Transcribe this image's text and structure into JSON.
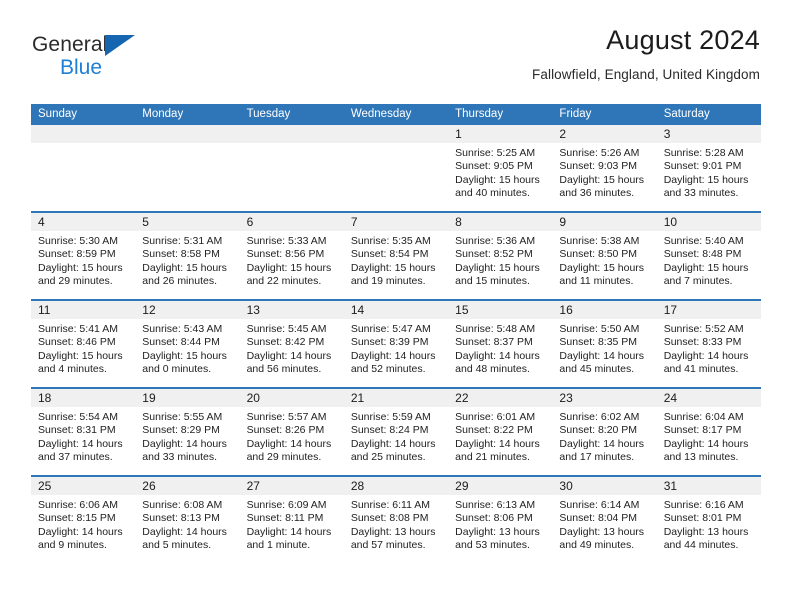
{
  "brand": {
    "name_part1": "General",
    "name_part2": "Blue",
    "accent_color": "#1e7fd4",
    "triangle_color": "#1565b0"
  },
  "header": {
    "title": "August 2024",
    "subtitle": "Fallowfield, England, United Kingdom"
  },
  "theme": {
    "header_blue": "#2f76b8",
    "day_number_band": "#f0f0f0",
    "text": "#222222"
  },
  "weekdays": [
    "Sunday",
    "Monday",
    "Tuesday",
    "Wednesday",
    "Thursday",
    "Friday",
    "Saturday"
  ],
  "weeks": [
    [
      {
        "day": "",
        "empty": true
      },
      {
        "day": "",
        "empty": true
      },
      {
        "day": "",
        "empty": true
      },
      {
        "day": "",
        "empty": true
      },
      {
        "day": "1",
        "sunrise": "Sunrise: 5:25 AM",
        "sunset": "Sunset: 9:05 PM",
        "daylight": "Daylight: 15 hours and 40 minutes."
      },
      {
        "day": "2",
        "sunrise": "Sunrise: 5:26 AM",
        "sunset": "Sunset: 9:03 PM",
        "daylight": "Daylight: 15 hours and 36 minutes."
      },
      {
        "day": "3",
        "sunrise": "Sunrise: 5:28 AM",
        "sunset": "Sunset: 9:01 PM",
        "daylight": "Daylight: 15 hours and 33 minutes."
      }
    ],
    [
      {
        "day": "4",
        "sunrise": "Sunrise: 5:30 AM",
        "sunset": "Sunset: 8:59 PM",
        "daylight": "Daylight: 15 hours and 29 minutes."
      },
      {
        "day": "5",
        "sunrise": "Sunrise: 5:31 AM",
        "sunset": "Sunset: 8:58 PM",
        "daylight": "Daylight: 15 hours and 26 minutes."
      },
      {
        "day": "6",
        "sunrise": "Sunrise: 5:33 AM",
        "sunset": "Sunset: 8:56 PM",
        "daylight": "Daylight: 15 hours and 22 minutes."
      },
      {
        "day": "7",
        "sunrise": "Sunrise: 5:35 AM",
        "sunset": "Sunset: 8:54 PM",
        "daylight": "Daylight: 15 hours and 19 minutes."
      },
      {
        "day": "8",
        "sunrise": "Sunrise: 5:36 AM",
        "sunset": "Sunset: 8:52 PM",
        "daylight": "Daylight: 15 hours and 15 minutes."
      },
      {
        "day": "9",
        "sunrise": "Sunrise: 5:38 AM",
        "sunset": "Sunset: 8:50 PM",
        "daylight": "Daylight: 15 hours and 11 minutes."
      },
      {
        "day": "10",
        "sunrise": "Sunrise: 5:40 AM",
        "sunset": "Sunset: 8:48 PM",
        "daylight": "Daylight: 15 hours and 7 minutes."
      }
    ],
    [
      {
        "day": "11",
        "sunrise": "Sunrise: 5:41 AM",
        "sunset": "Sunset: 8:46 PM",
        "daylight": "Daylight: 15 hours and 4 minutes."
      },
      {
        "day": "12",
        "sunrise": "Sunrise: 5:43 AM",
        "sunset": "Sunset: 8:44 PM",
        "daylight": "Daylight: 15 hours and 0 minutes."
      },
      {
        "day": "13",
        "sunrise": "Sunrise: 5:45 AM",
        "sunset": "Sunset: 8:42 PM",
        "daylight": "Daylight: 14 hours and 56 minutes."
      },
      {
        "day": "14",
        "sunrise": "Sunrise: 5:47 AM",
        "sunset": "Sunset: 8:39 PM",
        "daylight": "Daylight: 14 hours and 52 minutes."
      },
      {
        "day": "15",
        "sunrise": "Sunrise: 5:48 AM",
        "sunset": "Sunset: 8:37 PM",
        "daylight": "Daylight: 14 hours and 48 minutes."
      },
      {
        "day": "16",
        "sunrise": "Sunrise: 5:50 AM",
        "sunset": "Sunset: 8:35 PM",
        "daylight": "Daylight: 14 hours and 45 minutes."
      },
      {
        "day": "17",
        "sunrise": "Sunrise: 5:52 AM",
        "sunset": "Sunset: 8:33 PM",
        "daylight": "Daylight: 14 hours and 41 minutes."
      }
    ],
    [
      {
        "day": "18",
        "sunrise": "Sunrise: 5:54 AM",
        "sunset": "Sunset: 8:31 PM",
        "daylight": "Daylight: 14 hours and 37 minutes."
      },
      {
        "day": "19",
        "sunrise": "Sunrise: 5:55 AM",
        "sunset": "Sunset: 8:29 PM",
        "daylight": "Daylight: 14 hours and 33 minutes."
      },
      {
        "day": "20",
        "sunrise": "Sunrise: 5:57 AM",
        "sunset": "Sunset: 8:26 PM",
        "daylight": "Daylight: 14 hours and 29 minutes."
      },
      {
        "day": "21",
        "sunrise": "Sunrise: 5:59 AM",
        "sunset": "Sunset: 8:24 PM",
        "daylight": "Daylight: 14 hours and 25 minutes."
      },
      {
        "day": "22",
        "sunrise": "Sunrise: 6:01 AM",
        "sunset": "Sunset: 8:22 PM",
        "daylight": "Daylight: 14 hours and 21 minutes."
      },
      {
        "day": "23",
        "sunrise": "Sunrise: 6:02 AM",
        "sunset": "Sunset: 8:20 PM",
        "daylight": "Daylight: 14 hours and 17 minutes."
      },
      {
        "day": "24",
        "sunrise": "Sunrise: 6:04 AM",
        "sunset": "Sunset: 8:17 PM",
        "daylight": "Daylight: 14 hours and 13 minutes."
      }
    ],
    [
      {
        "day": "25",
        "sunrise": "Sunrise: 6:06 AM",
        "sunset": "Sunset: 8:15 PM",
        "daylight": "Daylight: 14 hours and 9 minutes."
      },
      {
        "day": "26",
        "sunrise": "Sunrise: 6:08 AM",
        "sunset": "Sunset: 8:13 PM",
        "daylight": "Daylight: 14 hours and 5 minutes."
      },
      {
        "day": "27",
        "sunrise": "Sunrise: 6:09 AM",
        "sunset": "Sunset: 8:11 PM",
        "daylight": "Daylight: 14 hours and 1 minute."
      },
      {
        "day": "28",
        "sunrise": "Sunrise: 6:11 AM",
        "sunset": "Sunset: 8:08 PM",
        "daylight": "Daylight: 13 hours and 57 minutes."
      },
      {
        "day": "29",
        "sunrise": "Sunrise: 6:13 AM",
        "sunset": "Sunset: 8:06 PM",
        "daylight": "Daylight: 13 hours and 53 minutes."
      },
      {
        "day": "30",
        "sunrise": "Sunrise: 6:14 AM",
        "sunset": "Sunset: 8:04 PM",
        "daylight": "Daylight: 13 hours and 49 minutes."
      },
      {
        "day": "31",
        "sunrise": "Sunrise: 6:16 AM",
        "sunset": "Sunset: 8:01 PM",
        "daylight": "Daylight: 13 hours and 44 minutes."
      }
    ]
  ]
}
